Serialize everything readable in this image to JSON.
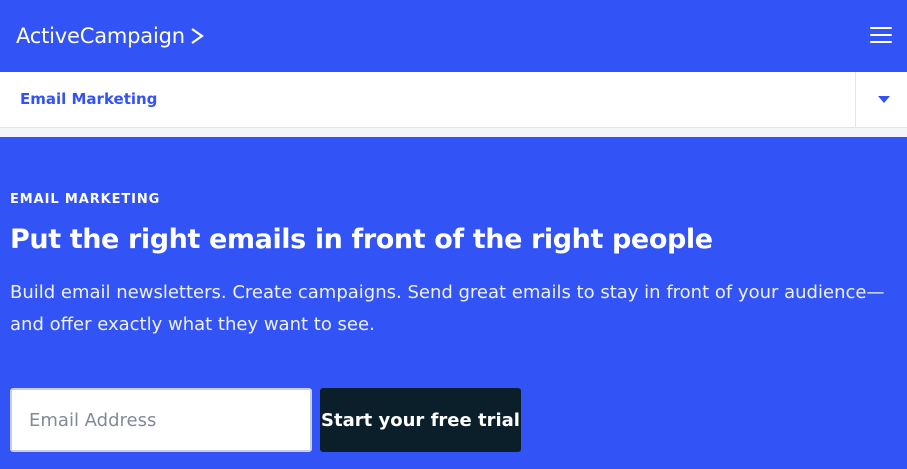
{
  "header": {
    "logo_text": "ActiveCampaign",
    "logo_icon": "chevron-right-icon",
    "menu_icon": "hamburger-menu-icon",
    "background_color": "#3253f5"
  },
  "subnav": {
    "label": "Email Marketing",
    "toggle_icon": "caret-down-icon"
  },
  "hero": {
    "eyebrow": "EMAIL MARKETING",
    "headline": "Put the right emails in front of the right people",
    "description": "Build email newsletters. Create campaigns. Send great emails to stay in front of your audience—and offer exactly what they want to see.",
    "email_placeholder": "Email Address",
    "email_value": "",
    "cta_label": "Start your free trial",
    "cta_color": "#0b1f2a"
  }
}
